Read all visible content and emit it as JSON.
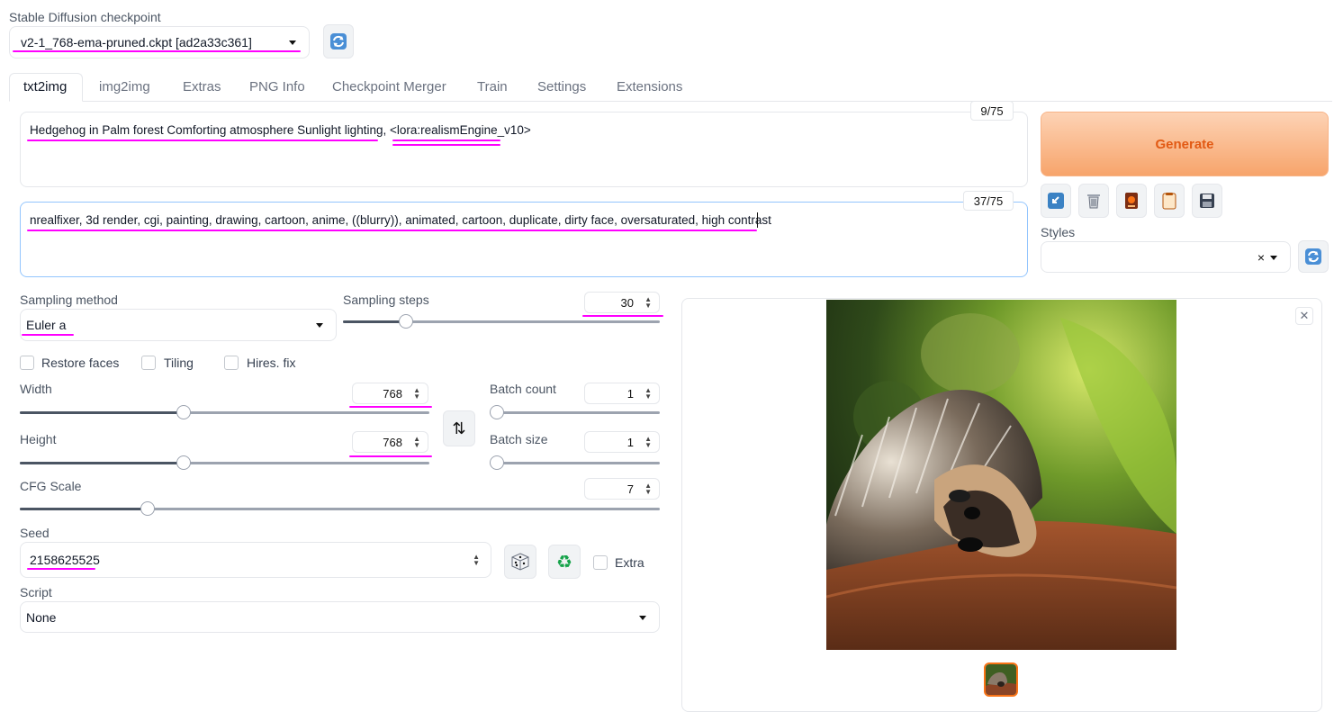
{
  "checkpoint": {
    "label": "Stable Diffusion checkpoint",
    "value": "v2-1_768-ema-pruned.ckpt [ad2a33c361]"
  },
  "tabs": [
    {
      "label": "txt2img",
      "active": true
    },
    {
      "label": "img2img"
    },
    {
      "label": "Extras"
    },
    {
      "label": "PNG Info"
    },
    {
      "label": "Checkpoint Merger"
    },
    {
      "label": "Train"
    },
    {
      "label": "Settings"
    },
    {
      "label": "Extensions"
    }
  ],
  "prompt": {
    "text": "Hedgehog in Palm forest Comforting atmosphere Sunlight lighting, <lora:realismEngine_v10>",
    "counter": "9/75"
  },
  "negative_prompt": {
    "text": "nrealfixer, 3d render, cgi, painting, drawing, cartoon, anime, ((blurry)), animated, cartoon, duplicate, dirty face, oversaturated, high contrast",
    "counter": "37/75"
  },
  "generate": {
    "label": "Generate",
    "color": "#f7a46b"
  },
  "styles": {
    "label": "Styles",
    "clear_symbol": "×"
  },
  "sampling": {
    "method_label": "Sampling method",
    "method_value": "Euler a",
    "steps_label": "Sampling steps",
    "steps_value": "30",
    "steps_fraction": 0.2
  },
  "checkboxes": {
    "restore_faces": "Restore faces",
    "tiling": "Tiling",
    "hires_fix": "Hires. fix",
    "extra": "Extra"
  },
  "width": {
    "label": "Width",
    "value": "768",
    "fraction": 0.4
  },
  "height": {
    "label": "Height",
    "value": "768",
    "fraction": 0.4
  },
  "batch_count": {
    "label": "Batch count",
    "value": "1",
    "fraction": 0.0
  },
  "batch_size": {
    "label": "Batch size",
    "value": "1",
    "fraction": 0.0
  },
  "cfg": {
    "label": "CFG Scale",
    "value": "7",
    "fraction": 0.2
  },
  "seed": {
    "label": "Seed",
    "value": "2158625525"
  },
  "script": {
    "label": "Script",
    "value": "None"
  },
  "icons": {
    "refresh": "refresh-icon",
    "swap": "swap-icon",
    "dice": "dice-icon",
    "recycle": "recycle-icon",
    "close": "close-icon",
    "toolbar": [
      "paste-icon",
      "trash-icon",
      "model-icon",
      "clipboard-icon",
      "save-icon"
    ]
  },
  "accent_color": "#ff00ff"
}
